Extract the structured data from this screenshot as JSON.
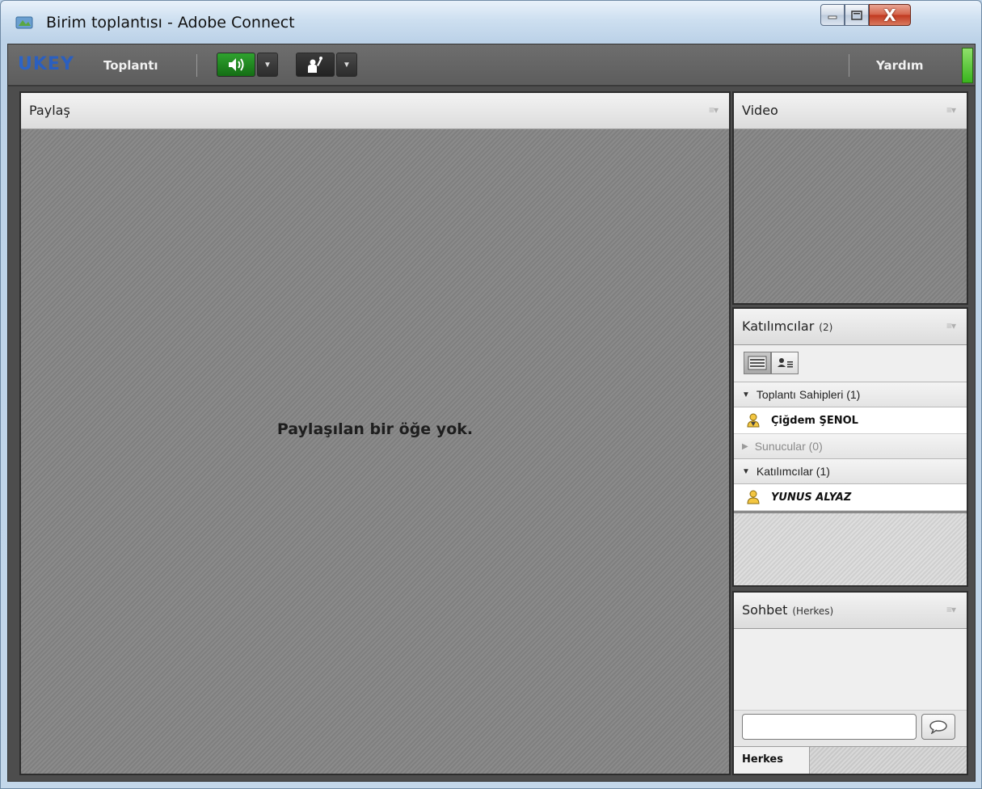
{
  "window": {
    "title": "Birim toplantısı - Adobe Connect",
    "controls": {
      "minimize": "minimize-icon",
      "maximize": "maximize-icon",
      "close": "X"
    }
  },
  "toolbar": {
    "logo_u": "U",
    "logo_key": "KEY",
    "meeting_menu": "Toplantı",
    "audio_icon": "speaker-icon",
    "raise_hand_icon": "raise-hand-icon",
    "help_menu": "Yardım",
    "accent_green": "#2fa22f"
  },
  "share_pod": {
    "title": "Paylaş",
    "empty_message": "Paylaşılan bir öğe yok."
  },
  "video_pod": {
    "title": "Video"
  },
  "attendees_pod": {
    "title": "Katılımcılar",
    "count": "(2)",
    "groups": [
      {
        "label": "Toplantı Sahipleri (1)",
        "expanded": true,
        "members": [
          {
            "name": "Çiğdem ŞENOL",
            "role": "host-icon"
          }
        ]
      },
      {
        "label": "Sunucular (0)",
        "expanded": false,
        "members": []
      },
      {
        "label": "Katılımcılar (1)",
        "expanded": true,
        "members": [
          {
            "name": "YUNUS ALYAZ",
            "role": "participant-icon"
          }
        ]
      }
    ]
  },
  "chat_pod": {
    "title": "Sohbet",
    "scope": "(Herkes)",
    "input_placeholder": "",
    "tab_label": "Herkes"
  }
}
